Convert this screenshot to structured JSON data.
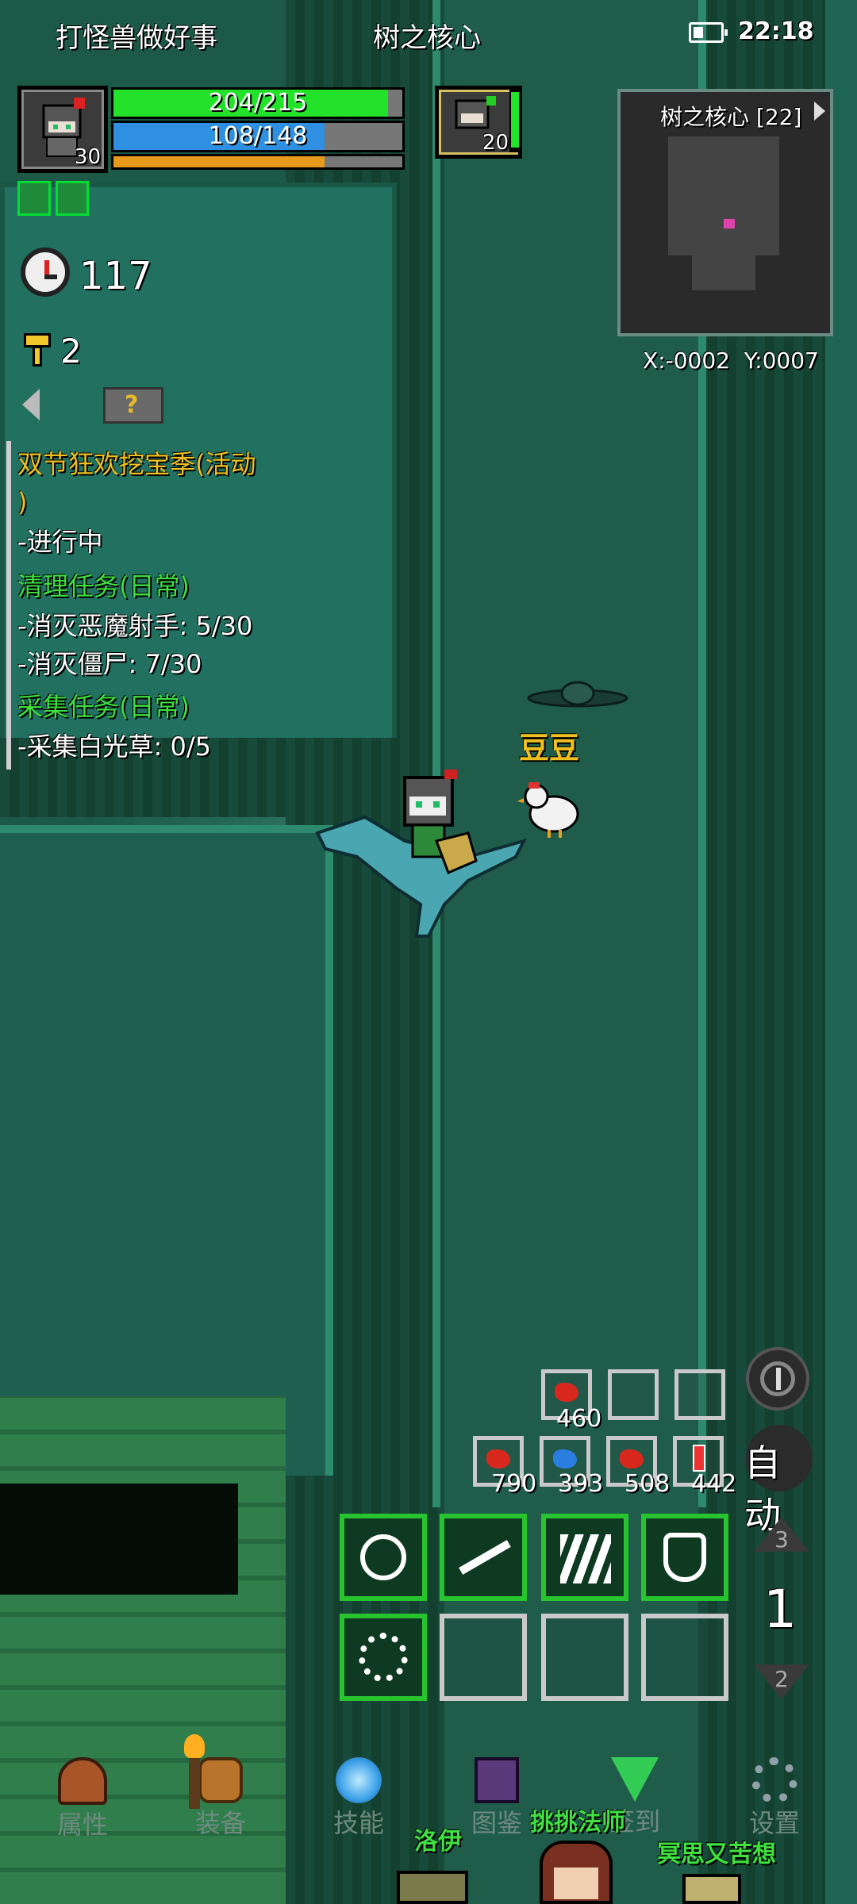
{
  "status_bar": {
    "left_title": "打怪兽做好事",
    "center_title": "树之核心",
    "time": "22:18"
  },
  "player": {
    "level": "30",
    "hp": "204/215",
    "mp": "108/148",
    "hp_fraction": 0.95,
    "mp_fraction": 0.73,
    "xp_fraction": 0.73
  },
  "pet": {
    "level": "20"
  },
  "minimap": {
    "title": "树之核心 [22]",
    "coords": "X:-0002  Y:0007"
  },
  "counters": {
    "timer": "117",
    "keys": "2"
  },
  "quests": {
    "event_title": "双节狂欢挖宝季(活动",
    "event_title_cont": ")",
    "event_status": "-进行中",
    "daily1_title": "清理任务(日常)",
    "daily1_line1": "-消灭恶魔射手: 5/30",
    "daily1_line2": "-消灭僵尸: 7/30",
    "daily2_title": "采集任务(日常)",
    "daily2_line1": "-采集白光草: 0/5"
  },
  "npcs": {
    "pet_name": "豆豆",
    "npc1": "洛伊",
    "npc2": "挑挑法师",
    "npc3": "冥思又苦想"
  },
  "quickslots": {
    "slot_top": "460",
    "slot1": "790",
    "slot2": "393",
    "slot3": "508",
    "slot4": "442"
  },
  "controls": {
    "auto_label": "自动",
    "page_up": "3",
    "page_current": "1",
    "page_down": "2"
  },
  "nav": {
    "items": [
      "属性",
      "装备",
      "技能",
      "图鉴",
      "签到",
      "设置"
    ]
  },
  "colors": {
    "hp": "#22e22a",
    "mp": "#2f8fe0",
    "xp": "#e89a1a",
    "quest_event": "#f0c020",
    "quest_daily": "#3fe03f",
    "npc_name": "#3fe03f",
    "pet_name": "#f0c020"
  },
  "icons": [
    "battery-icon",
    "helmet-icon",
    "alarm-clock-icon",
    "key-icon",
    "help-icon",
    "back-arrow-icon",
    "refresh-icon",
    "gear-icon",
    "book-icon",
    "gem-icon",
    "bag-icon",
    "orb-icon"
  ]
}
